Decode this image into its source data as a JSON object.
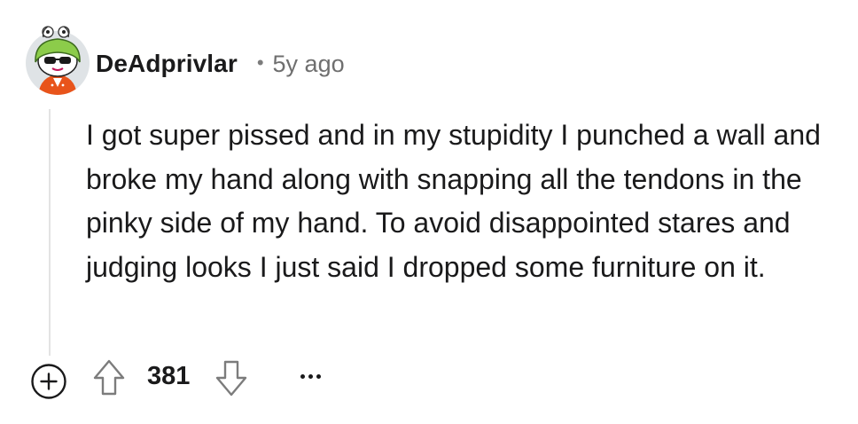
{
  "comment": {
    "author": "DeAdprivlar",
    "separator": "•",
    "timestamp": "5y ago",
    "body": "I got super pissed and in my stupidity I punched a wall and broke my hand along with snapping all the tendons in the pinky side of my hand. To avoid disappointed stares and judging looks I just said I dropped some furniture on it.",
    "score": "381"
  },
  "icons": {
    "avatar": "snoo-avatar-icon",
    "expand": "plus-circle-icon",
    "upvote": "upvote-arrow-icon",
    "downvote": "downvote-arrow-icon",
    "more": "more-dots-icon"
  },
  "colors": {
    "text": "#1a1a1b",
    "meta": "#6f6f6f",
    "thread_line": "#e3e3e3"
  }
}
